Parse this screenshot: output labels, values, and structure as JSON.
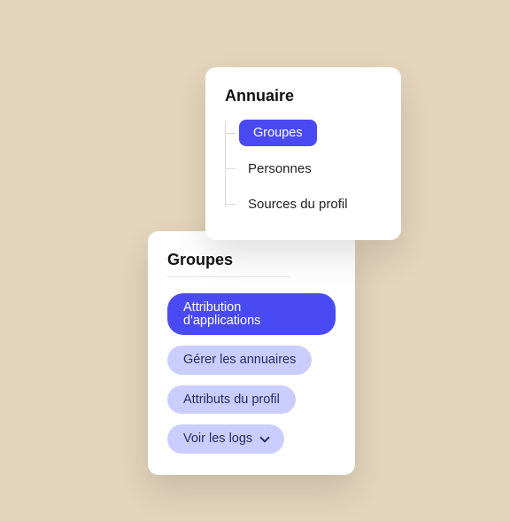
{
  "directory_card": {
    "title": "Annuaire",
    "items": [
      {
        "label": "Groupes",
        "active": true
      },
      {
        "label": "Personnes",
        "active": false
      },
      {
        "label": "Sources du profil",
        "active": false
      }
    ]
  },
  "groups_card": {
    "title": "Groupes",
    "buttons": [
      {
        "label": "Attribution d'applications",
        "variant": "primary"
      },
      {
        "label": "Gérer les annuaires",
        "variant": "light"
      },
      {
        "label": "Attributs du profil",
        "variant": "light"
      },
      {
        "label": "Voir les logs",
        "variant": "light",
        "dropdown": true
      }
    ]
  }
}
